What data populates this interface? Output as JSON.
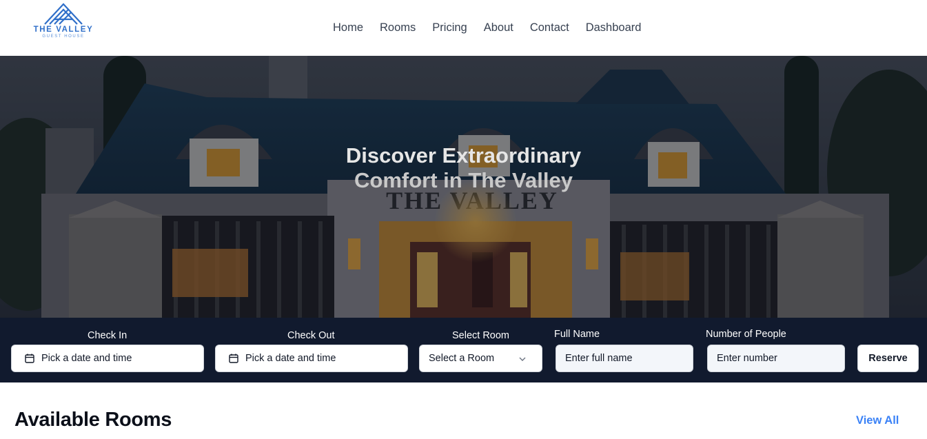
{
  "brand": {
    "name": "THE VALLEY",
    "tagline": "GUEST HOUSE",
    "color": "#2f6fc9"
  },
  "nav": {
    "items": [
      {
        "label": "Home"
      },
      {
        "label": "Rooms"
      },
      {
        "label": "Pricing"
      },
      {
        "label": "About"
      },
      {
        "label": "Contact"
      },
      {
        "label": "Dashboard"
      }
    ]
  },
  "hero": {
    "title_line1": "Discover Extraordinary",
    "title_line2": "Comfort in The Valley",
    "sign_text": "THE VALLEY"
  },
  "booking": {
    "check_in": {
      "label": "Check In",
      "value": "Pick a date and time",
      "icon": "calendar-icon"
    },
    "check_out": {
      "label": "Check Out",
      "value": "Pick a date and time",
      "icon": "calendar-icon"
    },
    "room": {
      "label": "Select Room",
      "value": "Select a Room",
      "icon": "chevron-down-icon"
    },
    "full_name": {
      "label": "Full Name",
      "placeholder": "Enter full name"
    },
    "people": {
      "label": "Number of People",
      "placeholder": "Enter number"
    },
    "reserve_label": "Reserve",
    "background": "#111a2e"
  },
  "rooms_section": {
    "title": "Available Rooms",
    "view_all": "View All",
    "link_color": "#3b82f6"
  }
}
